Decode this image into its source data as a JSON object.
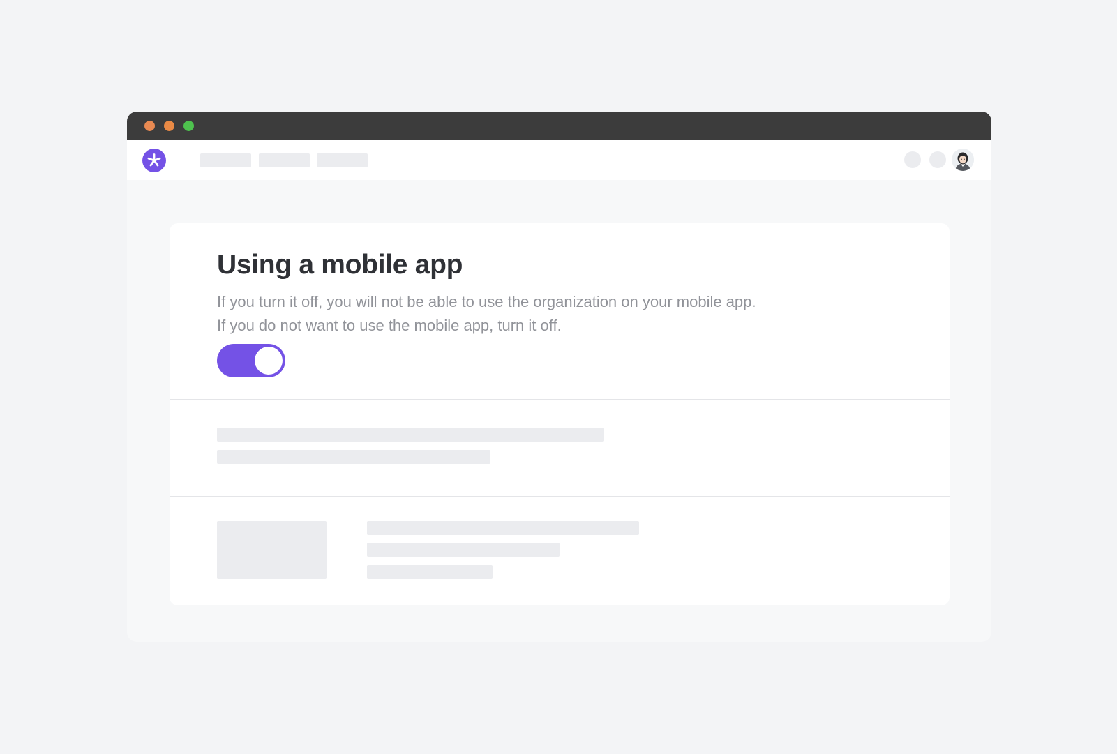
{
  "colors": {
    "page_background": "#f3f4f6",
    "titlebar": "#3c3c3c",
    "traffic_close": "#e98a52",
    "traffic_minimize": "#ea8a45",
    "traffic_maximize": "#4ec14e",
    "accent": "#7452e6",
    "placeholder": "#ebecef"
  },
  "header": {
    "logo_icon": "asterisk-logo-icon",
    "avatar_icon": "user-avatar-icon"
  },
  "settings": {
    "title": "Using a mobile app",
    "description_line1": "If you turn it off, you will not be able to use the organization on your mobile app.",
    "description_line2": "If you do not want to use the mobile app, turn it off.",
    "toggle_state": "on"
  }
}
